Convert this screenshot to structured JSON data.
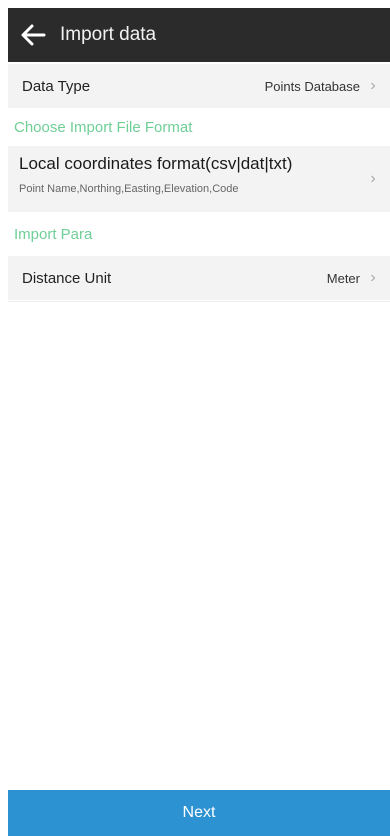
{
  "header": {
    "title": "Import data",
    "back_icon": "arrow-left-icon"
  },
  "data_type": {
    "label": "Data Type",
    "value": "Points Database"
  },
  "sections": {
    "file_format": "Choose Import File Format",
    "import_para": "Import Para"
  },
  "file_format": {
    "title": "Local coordinates format(csv|dat|txt)",
    "subtitle": "Point Name,Northing,Easting,Elevation,Code"
  },
  "distance_unit": {
    "label": "Distance Unit",
    "value": "Meter"
  },
  "footer": {
    "next_label": "Next"
  },
  "colors": {
    "appbar": "#2b2b2b",
    "section_header": "#6fcf97",
    "next_button": "#2d92d2",
    "row_background": "#f3f3f3"
  }
}
